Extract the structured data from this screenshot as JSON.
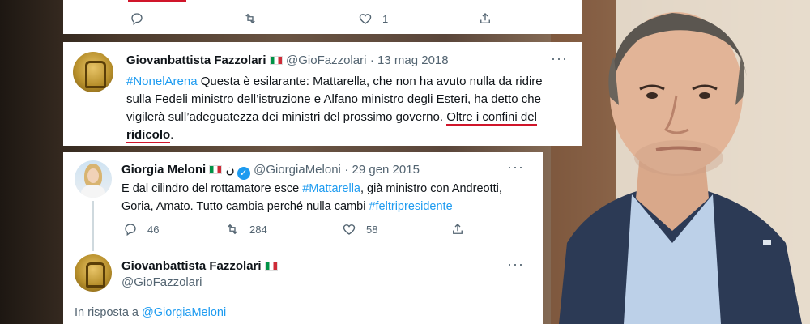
{
  "top_card": {
    "reply_icon": "reply-icon",
    "retweet_icon": "retweet-icon",
    "like_icon": "heart-icon",
    "like_count": "1",
    "share_icon": "share-icon"
  },
  "tweet1": {
    "name": "Giovanbattista Fazzolari",
    "handle": "@GioFazzolari",
    "date": "· 13 mag 2018",
    "more": "···",
    "hashtag": "#NonelArena",
    "text_a": " Questa è esilarante: Mattarella, che non ha avuto nulla da ridire sulla Fedeli ministro dell’istruzione e Alfano ministro degli Esteri, ha detto che vigilerà sull’adeguatezza dei ministri del prossimo governo. ",
    "highlight_1": "Oltre i confini del ",
    "highlight_2": "ridicolo",
    "text_end": "."
  },
  "tweet2": {
    "name": "Giorgia Meloni",
    "extra": "ن",
    "handle": "@GiorgiaMeloni",
    "date": "· 29 gen 2015",
    "more": "···",
    "text_a": "E dal cilindro del rottamatore esce ",
    "hashtag1": "#Mattarella",
    "text_b": ", già ministro con Andreotti, Goria, Amato. Tutto cambia perché nulla cambi ",
    "hashtag2": "#feltripresidente",
    "replies": "46",
    "retweets": "284",
    "likes": "58"
  },
  "tweet3": {
    "name": "Giovanbattista Fazzolari",
    "handle": "@GioFazzolari",
    "more": "···",
    "reply_prefix": "In risposta a ",
    "reply_to": "@GiorgiaMeloni"
  }
}
